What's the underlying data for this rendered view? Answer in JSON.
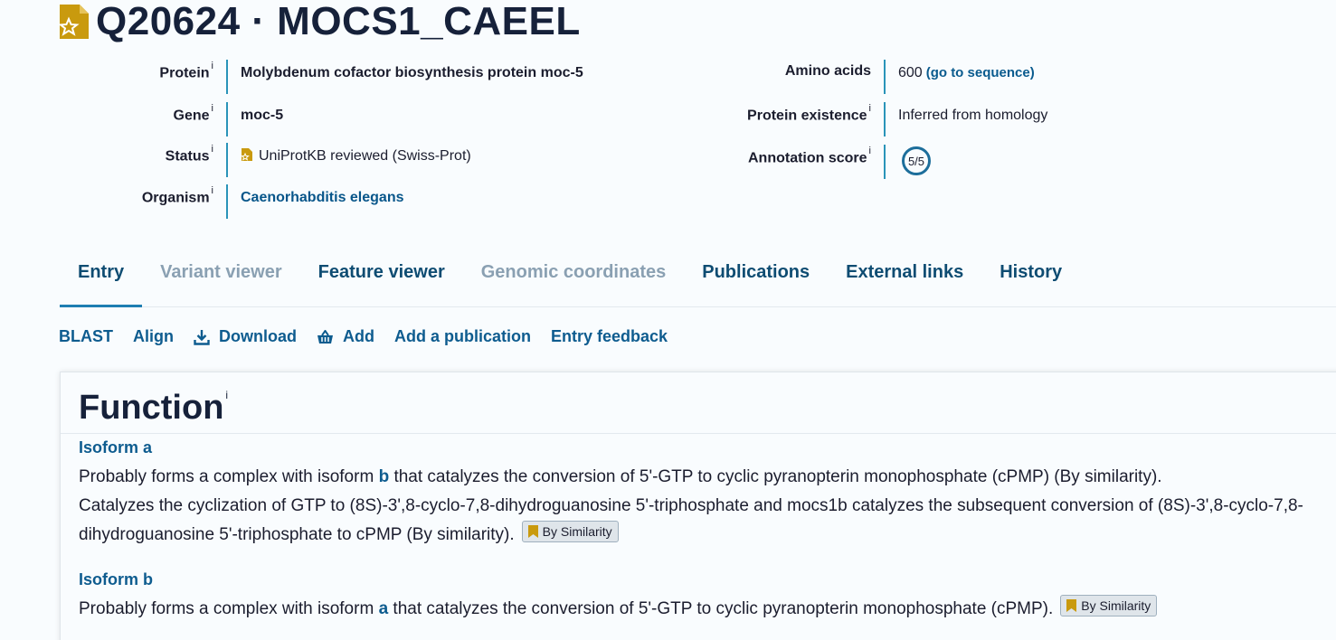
{
  "header": {
    "title": "Q20624 · MOCS1_CAEEL",
    "icon": "reviewed-doc-icon"
  },
  "info_left": [
    {
      "label": "Protein",
      "info": "i",
      "value": "Molybdenum cofactor biosynthesis protein moc-5"
    },
    {
      "label": "Gene",
      "info": "i",
      "value": "moc-5"
    },
    {
      "label": "Status",
      "info": "i",
      "value": "UniProtKB reviewed (Swiss-Prot)"
    },
    {
      "label": "Organism",
      "info": "i",
      "value": "Caenorhabditis elegans"
    }
  ],
  "info_right": [
    {
      "label": "Amino acids",
      "value": "600",
      "link": "(go to sequence)"
    },
    {
      "label": "Protein existence",
      "info": "i",
      "value": "Inferred from homology"
    },
    {
      "label": "Annotation score",
      "info": "i",
      "value": "5/5"
    }
  ],
  "tabs": [
    {
      "label": "Entry",
      "state": "active"
    },
    {
      "label": "Variant viewer",
      "state": "disabled"
    },
    {
      "label": "Feature viewer",
      "state": "normal"
    },
    {
      "label": "Genomic coordinates",
      "state": "disabled"
    },
    {
      "label": "Publications",
      "state": "normal"
    },
    {
      "label": "External links",
      "state": "normal"
    },
    {
      "label": "History",
      "state": "normal"
    }
  ],
  "toolbar": {
    "blast": "BLAST",
    "align": "Align",
    "download": "Download",
    "add": "Add",
    "add_publication": "Add a publication",
    "feedback": "Entry feedback"
  },
  "function": {
    "title": "Function",
    "info": "i",
    "isoform_a": {
      "heading": "Isoform a",
      "p1_pre": "Probably forms a complex with isoform ",
      "p1_link": "b",
      "p1_post": " that catalyzes the conversion of 5'-GTP to cyclic pyranopterin monophosphate (cPMP) (By similarity).",
      "p2": "Catalyzes the cyclization of GTP to (8S)-3',8-cyclo-7,8-dihydroguanosine 5'-triphosphate and mocs1b catalyzes the subsequent conversion of (8S)-3',8-cyclo-7,8-dihydroguanosine 5'-triphosphate to cPMP (By similarity).",
      "evidence": "By Similarity"
    },
    "isoform_b": {
      "heading": "Isoform b",
      "p1_pre": "Probably forms a complex with isoform ",
      "p1_link": "a",
      "p1_post": " that catalyzes the conversion of 5'-GTP to cyclic pyranopterin monophosphate (cPMP).",
      "evidence": "By Similarity"
    }
  },
  "colors": {
    "accent": "#0e5c8f",
    "separator": "#2a94b9",
    "reviewed_gold": "#c99a0e"
  }
}
